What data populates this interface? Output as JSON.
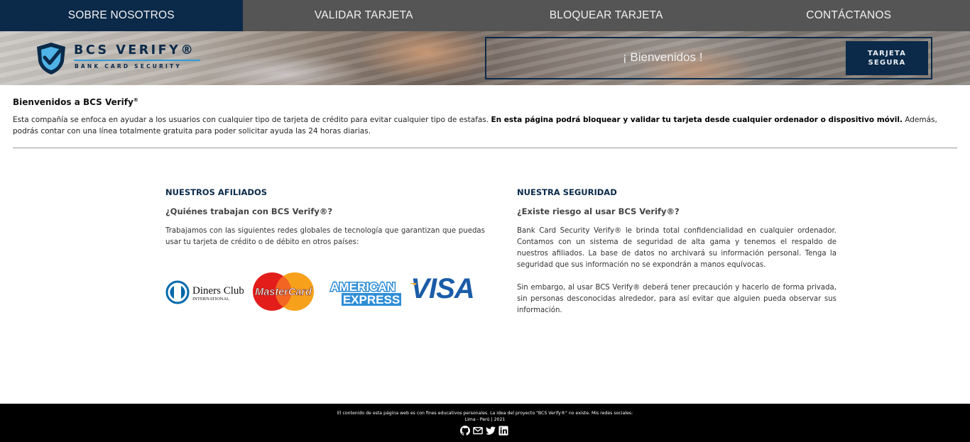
{
  "nav": {
    "items": [
      {
        "label": "SOBRE NOSOTROS",
        "active": true
      },
      {
        "label": "VALIDAR TARJETA",
        "active": false
      },
      {
        "label": "BLOQUEAR TARJETA",
        "active": false
      },
      {
        "label": "CONTÁCTANOS",
        "active": false
      }
    ]
  },
  "hero": {
    "logo_title": "BCS VERIFY®",
    "logo_subtitle": "BANK CARD SECURITY",
    "welcome": "¡ Bienvenidos !",
    "secure_button": "TARJETA SEGURA"
  },
  "intro": {
    "title": "Bienvenidos a BCS Verify",
    "title_mark": "®",
    "text_before": "Esta compañía se enfoca en ayudar a los usuarios con cualquier tipo de tarjeta de crédito para evitar cualquier tipo de estafas. ",
    "text_bold": "En esta página podrá bloquear y validar tu tarjeta desde cualquier ordenador o dispositivo móvil.",
    "text_after": " Además, podrás contar con una línea totalmente gratuita para poder solicitar ayuda las 24 horas diarias."
  },
  "affiliates": {
    "heading": "NUESTROS AFILIADOS",
    "subheading": "¿Quiénes trabajan con BCS Verify®?",
    "text": "Trabajamos con las siguientes redes globales de tecnología que garantizan que puedas usar tu tarjeta de crédito o de débito en otros países:",
    "logos": [
      "Diners Club International",
      "MasterCard",
      "American Express",
      "VISA"
    ],
    "diners_line1": "Diners Club",
    "diners_line2": "INTERNATIONAL",
    "mastercard": "MasterCard",
    "amex_line1": "AMERICAN",
    "amex_line2": "EXPRESS",
    "visa": "VISA"
  },
  "security": {
    "heading": "NUESTRA SEGURIDAD",
    "subheading": "¿Existe riesgo al usar BCS Verify®?",
    "p1": "Bank Card Security Verify® le brinda total confidencialidad en cualquier ordenador. Contamos con un sistema de seguridad de alta gama y tenemos el respaldo de nuestros afiliados. La base de datos no archivará su información personal. Tenga la seguridad que sus información no se expondrán a manos equívocas.",
    "p2": "Sin embargo, al usar BCS Verify® deberá tener precaución y hacerlo de forma privada, sin personas desconocidas alrededor, para así evitar que alguien pueda observar sus información."
  },
  "footer": {
    "line1": "El contenido de esta página web es con fines educativos personales. La idea del proyecto \"BCS Verify®\" no existe. Mis redes sociales:",
    "line2": "Lima - Perú | 2021",
    "social_icons": [
      "github-icon",
      "mail-icon",
      "twitter-icon",
      "linkedin-icon"
    ]
  },
  "colors": {
    "nav_bg": "#555555",
    "nav_active": "#0b2a4a",
    "brand_navy": "#0b2a4a",
    "brand_blue": "#2f9bd7",
    "footer_bg": "#000000"
  }
}
